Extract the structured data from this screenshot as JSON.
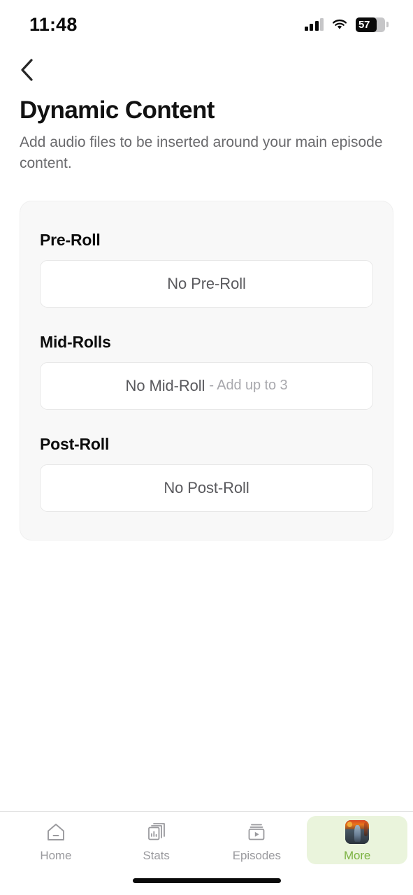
{
  "status_bar": {
    "time": "11:48",
    "battery_level": "57",
    "signal_icon": "cellular-signal-icon",
    "wifi_icon": "wifi-icon",
    "battery_icon": "battery-icon"
  },
  "nav": {
    "back_icon": "chevron-left-icon"
  },
  "header": {
    "title": "Dynamic Content",
    "subtitle": "Add audio files to be inserted around your main episode content."
  },
  "sections": [
    {
      "title": "Pre-Roll",
      "slot_label": "No Pre-Roll",
      "slot_hint": ""
    },
    {
      "title": "Mid-Rolls",
      "slot_label": "No Mid-Roll",
      "slot_hint": "- Add up to 3"
    },
    {
      "title": "Post-Roll",
      "slot_label": "No Post-Roll",
      "slot_hint": ""
    }
  ],
  "tab_bar": {
    "active_color": "#7cb342",
    "active_pill_color": "#eaf4dc",
    "inactive_color": "#9a9a9e",
    "items": [
      {
        "label": "Home",
        "icon": "house-icon",
        "active": false
      },
      {
        "label": "Stats",
        "icon": "chart-pages-icon",
        "active": false
      },
      {
        "label": "Episodes",
        "icon": "episodes-play-box-icon",
        "active": false
      },
      {
        "label": "More",
        "icon": "podcast-artwork-thumbnail",
        "active": true
      }
    ]
  }
}
